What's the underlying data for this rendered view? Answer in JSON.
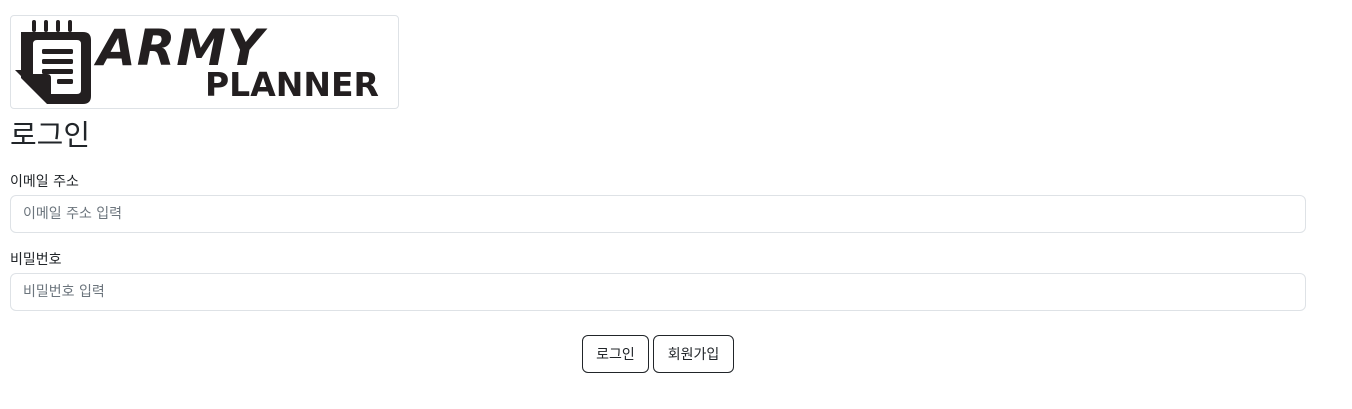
{
  "logo": {
    "line1": "ARMY",
    "line2": "PLANNER",
    "icon": "notepad-icon"
  },
  "title": "로그인",
  "email": {
    "label": "이메일 주소",
    "placeholder": "이메일 주소 입력",
    "value": ""
  },
  "password": {
    "label": "비밀번호",
    "placeholder": "비밀번호 입력",
    "value": ""
  },
  "buttons": {
    "login": "로그인",
    "signup": "회원가입"
  }
}
